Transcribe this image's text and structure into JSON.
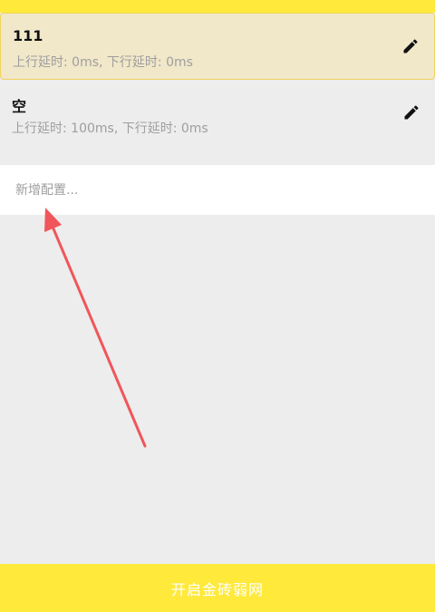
{
  "configs": [
    {
      "name": "111",
      "detail": "上行延时: 0ms, 下行延时: 0ms",
      "selected": true,
      "edit_icon": "pencil-icon"
    },
    {
      "name": "空",
      "detail": "上行延时: 100ms, 下行延时: 0ms",
      "selected": false,
      "edit_icon": "pencil-icon"
    }
  ],
  "add_config": {
    "placeholder": "新增配置..."
  },
  "annotation": {
    "type": "arrow",
    "color": "#f0565a"
  },
  "start_button": {
    "label": "开启金砖弱网"
  },
  "colors": {
    "accent": "#ffe93b",
    "selected_bg": "#f1e7c9",
    "page_bg": "#ededed",
    "secondary_text": "#9e9e9e"
  }
}
